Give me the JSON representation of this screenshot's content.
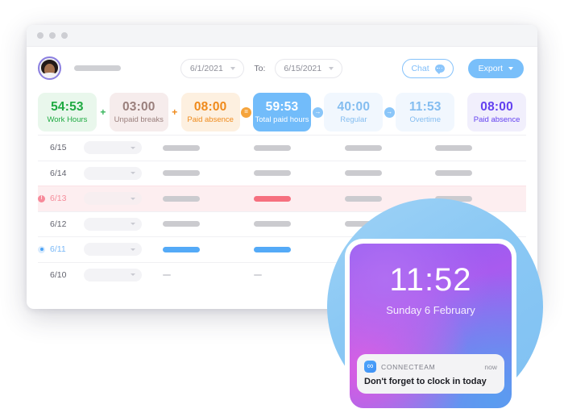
{
  "window": {
    "traffic_lights": [
      "close",
      "minimize",
      "maximize"
    ]
  },
  "header": {
    "avatar_name": "avatar",
    "date_from": "6/1/2021",
    "to_label": "To:",
    "date_to": "6/15/2021",
    "chat_label": "Chat",
    "export_label": "Export"
  },
  "stats": {
    "cards": [
      {
        "value": "54:53",
        "label": "Work Hours",
        "theme": "green"
      },
      {
        "value": "03:00",
        "label": "Unpaid breaks",
        "theme": "rose"
      },
      {
        "value": "08:00",
        "label": "Paid absence",
        "theme": "orange"
      },
      {
        "value": "59:53",
        "label": "Total paid hours",
        "theme": "blue-solid"
      },
      {
        "value": "40:00",
        "label": "Regular",
        "theme": "blue-pale"
      },
      {
        "value": "11:53",
        "label": "Overtime",
        "theme": "blue-pale"
      },
      {
        "value": "08:00",
        "label": "Paid absence",
        "theme": "purple"
      }
    ],
    "operators": [
      "+",
      "+",
      "=",
      "→",
      "→"
    ]
  },
  "table": {
    "rows": [
      {
        "date": "6/15",
        "status": "none",
        "bars": [
          "gray",
          "gray",
          "gray",
          "gray"
        ]
      },
      {
        "date": "6/14",
        "status": "none",
        "bars": [
          "gray",
          "gray",
          "gray",
          "gray"
        ]
      },
      {
        "date": "6/13",
        "status": "alert",
        "bars": [
          "gray",
          "red",
          "gray",
          "gray"
        ]
      },
      {
        "date": "6/12",
        "status": "none",
        "bars": [
          "gray",
          "gray",
          "gray",
          "gray"
        ]
      },
      {
        "date": "6/11",
        "status": "active",
        "bars": [
          "blue",
          "blue",
          "gray",
          "gray"
        ]
      },
      {
        "date": "6/10",
        "status": "none",
        "bars": [
          "dash",
          "dash",
          "indigo",
          "none"
        ]
      }
    ]
  },
  "phone": {
    "time": "11:52",
    "date": "Sunday 6 February",
    "notification": {
      "brand": "CONNECTEAM",
      "timestamp": "now",
      "message": "Don't forget to clock in today",
      "logo_glyph": "∞"
    }
  },
  "colors": {
    "accent_blue": "#72bcfa",
    "green": "#1faa42",
    "orange": "#ef8a1b",
    "purple": "#6341f0",
    "alert_red": "#f6707f"
  }
}
